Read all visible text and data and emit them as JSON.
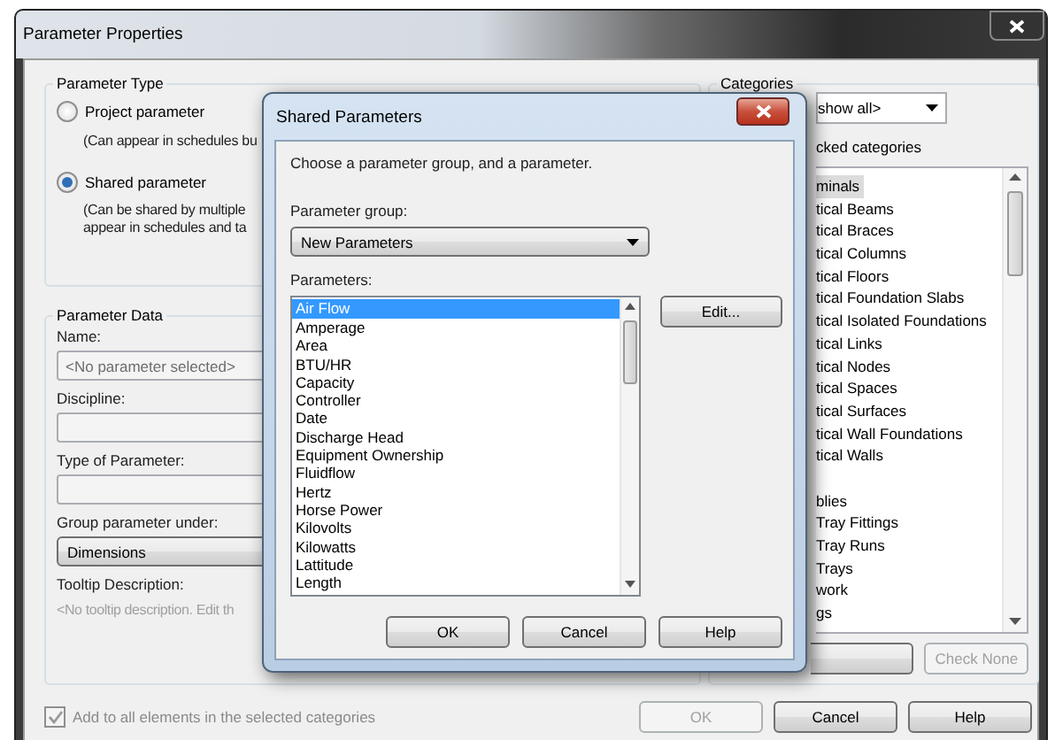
{
  "window": {
    "title": "Parameter Properties"
  },
  "parameter_type": {
    "title": "Parameter Type",
    "options": [
      {
        "label": "Project parameter",
        "note": "(Can appear in schedules bu",
        "selected": false
      },
      {
        "label": "Shared parameter",
        "note": "(Can be shared by multiple\nappear in schedules and ta",
        "selected": true
      }
    ]
  },
  "parameter_data": {
    "title": "Parameter Data",
    "name_label": "Name:",
    "name_placeholder": "<No parameter selected>",
    "discipline_label": "Discipline:",
    "type_label": "Type of Parameter:",
    "group_label": "Group parameter under:",
    "group_value": "Dimensions",
    "tooltip_label": "Tooltip Description:",
    "tooltip_text": "<No tooltip description. Edit th"
  },
  "categories": {
    "title": "Categories",
    "filter_value": "show all>",
    "hide_label": "cked categories",
    "items": [
      {
        "label": "minals",
        "selected": true
      },
      {
        "label": "tical Beams",
        "selected": false
      },
      {
        "label": "tical Braces",
        "selected": false
      },
      {
        "label": "tical Columns",
        "selected": false
      },
      {
        "label": "tical Floors",
        "selected": false
      },
      {
        "label": "tical Foundation Slabs",
        "selected": false
      },
      {
        "label": "tical Isolated Foundations",
        "selected": false
      },
      {
        "label": "tical Links",
        "selected": false
      },
      {
        "label": "tical Nodes",
        "selected": false
      },
      {
        "label": "tical Spaces",
        "selected": false
      },
      {
        "label": "tical Surfaces",
        "selected": false
      },
      {
        "label": "tical Wall Foundations",
        "selected": false
      },
      {
        "label": "tical Walls",
        "selected": false
      },
      {
        "label": "blies",
        "selected": false
      },
      {
        "label": "Tray Fittings",
        "selected": false
      },
      {
        "label": "Tray Runs",
        "selected": false
      },
      {
        "label": "Trays",
        "selected": false
      },
      {
        "label": "work",
        "selected": false
      },
      {
        "label": "gs",
        "selected": false
      }
    ],
    "check_none": {
      "label": "Check None",
      "disabled": true
    }
  },
  "add_to_all": {
    "label": "Add to all elements in the selected categories",
    "checked": true,
    "disabled": true
  },
  "buttons": [
    {
      "label": "OK",
      "disabled": true
    },
    {
      "label": "Cancel",
      "disabled": false
    },
    {
      "label": "Help",
      "disabled": false
    }
  ],
  "dialog": {
    "title": "Shared Parameters",
    "instruction": "Choose a parameter group, and a parameter.",
    "group_label": "Parameter group:",
    "group_value": "New Parameters",
    "list_label": "Parameters:",
    "edit_button": "Edit...",
    "parameters": [
      {
        "label": "Air Flow",
        "selected": true
      },
      {
        "label": "Amperage",
        "selected": false
      },
      {
        "label": "Area",
        "selected": false
      },
      {
        "label": "BTU/HR",
        "selected": false
      },
      {
        "label": "Capacity",
        "selected": false
      },
      {
        "label": "Controller",
        "selected": false
      },
      {
        "label": "Date",
        "selected": false
      },
      {
        "label": "Discharge Head",
        "selected": false
      },
      {
        "label": "Equipment Ownership",
        "selected": false
      },
      {
        "label": "Fluidflow",
        "selected": false
      },
      {
        "label": "Hertz",
        "selected": false
      },
      {
        "label": "Horse Power",
        "selected": false
      },
      {
        "label": "Kilovolts",
        "selected": false
      },
      {
        "label": "Kilowatts",
        "selected": false
      },
      {
        "label": "Lattitude",
        "selected": false
      },
      {
        "label": "Length",
        "selected": false
      }
    ],
    "buttons": [
      "OK",
      "Cancel",
      "Help"
    ]
  }
}
